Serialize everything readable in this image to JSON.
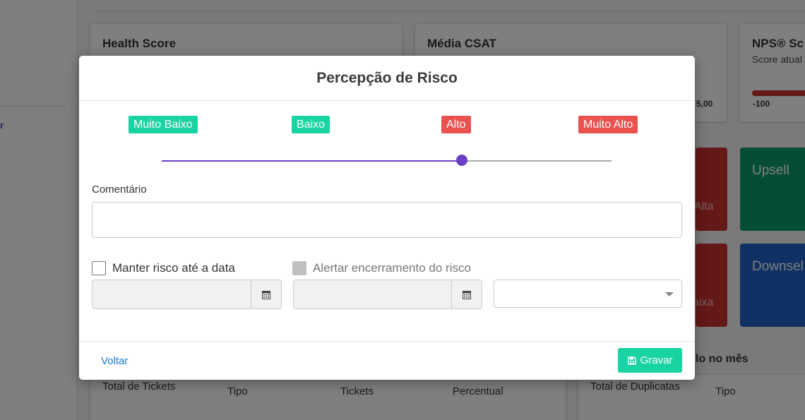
{
  "background": {
    "sidebar_fragment": "r",
    "cards": [
      {
        "title": "Health Score",
        "subtitle": ""
      },
      {
        "title": "Média CSAT",
        "subtitle": ""
      },
      {
        "title": "NPS® Sc",
        "subtitle": "Score atual"
      }
    ],
    "csat_max": "5,00",
    "nps_min": "-100",
    "tiles": [
      {
        "label": "",
        "sub": "Alta",
        "color": "#c8312f"
      },
      {
        "label": "Upsell",
        "sub": "",
        "color": "#0d9b6f"
      },
      {
        "label": "",
        "sub": "aixa",
        "color": "#c8312f"
      },
      {
        "label": "Downsel",
        "sub": "",
        "color": "#1f63c6"
      }
    ],
    "section_title_right": "lo no mês",
    "tickets_table": {
      "title": "Total de Tickets",
      "headers": [
        "Tipo",
        "Tickets",
        "Percentual"
      ]
    },
    "dup_table": {
      "title": "Total de Duplicatas",
      "headers": [
        "Tipo"
      ]
    }
  },
  "modal": {
    "title": "Percepção de Risco",
    "risk_levels": [
      {
        "label": "Muito Baixo",
        "color": "#19d3a2"
      },
      {
        "label": "Baixo",
        "color": "#19d3a2"
      },
      {
        "label": "Alto",
        "color": "#e9524f"
      },
      {
        "label": "Muito Alto",
        "color": "#e9524f"
      }
    ],
    "slider": {
      "selected_level": "Alto",
      "value_fraction": 0.667,
      "color": "#6a3fc1"
    },
    "comment": {
      "label": "Comentário",
      "value": ""
    },
    "keep_risk": {
      "label": "Manter risco até a data",
      "checked": false,
      "date": ""
    },
    "alert_end": {
      "label": "Alertar encerramento do risco",
      "checked": false,
      "disabled": true,
      "date": ""
    },
    "alert_select": {
      "value": ""
    },
    "footer": {
      "back_label": "Voltar",
      "save_label": "Gravar"
    },
    "icons": {
      "calendar": "calendar-icon",
      "save": "floppy-disk-icon"
    }
  }
}
